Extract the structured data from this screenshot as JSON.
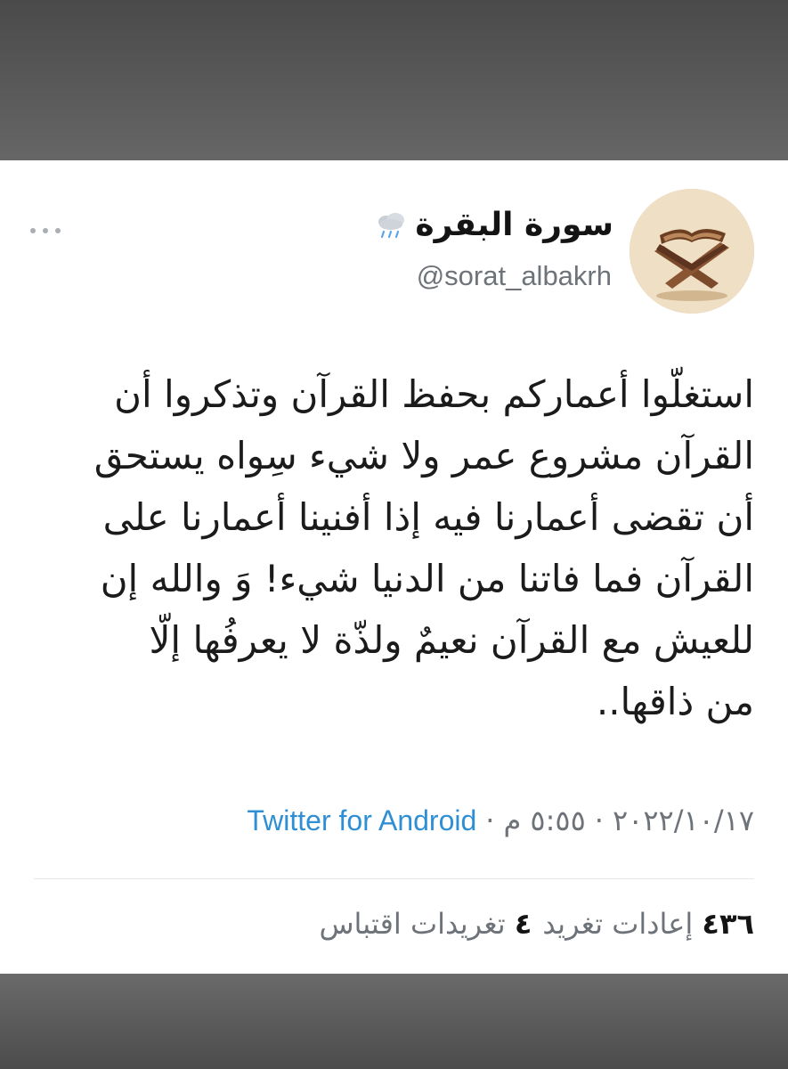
{
  "tweet": {
    "display_name": "سورة البقرة",
    "name_emoji_icon": "cloud-with-rain-icon",
    "handle": "@sorat_albakrh",
    "more_icon": "more-dots-icon",
    "text": "استغلّوا أعماركم بحفظ القرآن وتذكروا أن\nالقرآن مشروع عمر ولا شيء سِواه يستحق\nأن تقضى أعمارنا فيه إذا أفنينا أعمارنا على\nالقرآن فما فاتنا من الدنيا شيء! وَ والله إن\nللعيش مع القرآن نعيمٌ ولذّة لا يعرفُها إلّا\nمن ذاقها..",
    "date": "٢٠٢٢/١٠/١٧",
    "separator": "·",
    "time": "٥:٥٥ م",
    "source": "Twitter for Android",
    "stats": {
      "retweets_count": "٤٣٦",
      "retweets_label": "إعادات تغريد",
      "quotes_count": "٤",
      "quotes_label": "تغريدات اقتباس"
    }
  },
  "colors": {
    "text": "#1b1b1b",
    "secondary": "#6e7379",
    "link": "#2f8fd4",
    "divider": "#e4e6e8",
    "frame": "#5c5c5c"
  }
}
